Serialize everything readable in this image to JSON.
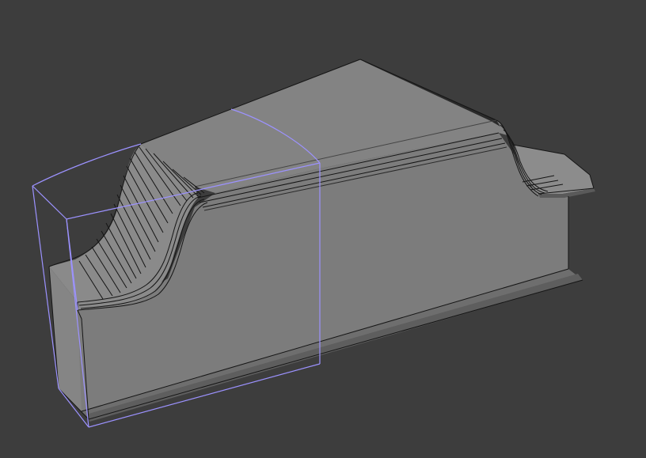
{
  "viewport": {
    "background": "#3d3d3d",
    "view_type": "3d-perspective"
  },
  "model": {
    "kind": "extruded-solid-mesh",
    "display_mode": "shaded-with-wireframe-edges",
    "shading_colors": {
      "front_face": "#7c7c7c",
      "top_face": "#838383",
      "side_face": "#858585",
      "flange": "#6e6e6e",
      "edge_lines": "#151515"
    }
  },
  "selection": {
    "kind": "bounding-cage",
    "color": "#9c92ff",
    "selected": true
  }
}
